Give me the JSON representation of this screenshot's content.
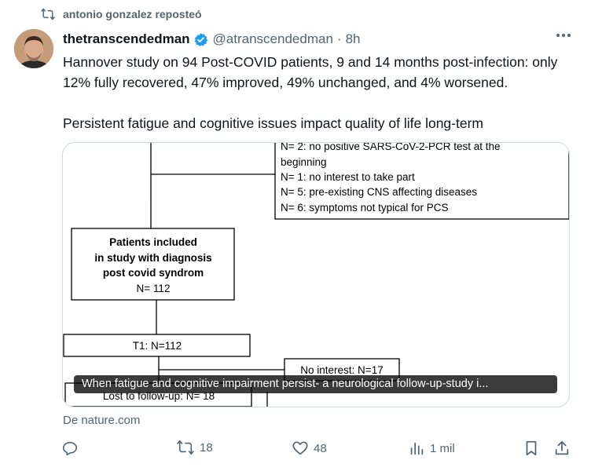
{
  "repost": {
    "label": "antonio gonzalez reposteó"
  },
  "post": {
    "author_name": "thetranscendedman",
    "handle": "@atranscendedman",
    "separator": "·",
    "time": "8h",
    "paragraphs": [
      "Hannover study on 94 Post-COVID patients, 9 and 14 months post-infection: only 12% fully recovered, 47% improved, 49% unchanged, and 4% worsened.",
      "Persistent fatigue and cognitive issues impact quality of life long-term"
    ]
  },
  "card": {
    "caption": "When fatigue and cognitive impairment persist- a neurological follow-up-study i...",
    "source": "De nature.com",
    "flowchart": {
      "exclusions": [
        "N= 2: no positive SARS-CoV-2-PCR test at the",
        "beginning",
        "N= 1: no interest to take part",
        "N= 5: pre-existing CNS affecting diseases",
        "N= 6: symptoms not typical for PCS"
      ],
      "included": [
        "Patients included",
        "in study with diagnosis",
        "post covid syndrom",
        "N= 112"
      ],
      "t1": "T1: N=112",
      "no_interest": "No interest: N=17",
      "lost": "Lost to follow-up: N= 18"
    }
  },
  "actions": {
    "reply_count": "",
    "repost_count": "18",
    "like_count": "48",
    "views_count": "1 mil"
  },
  "colors": {
    "text": "#0f1419",
    "secondary": "#536471",
    "verified": "#1d9bf0",
    "border": "#cfd9de"
  }
}
